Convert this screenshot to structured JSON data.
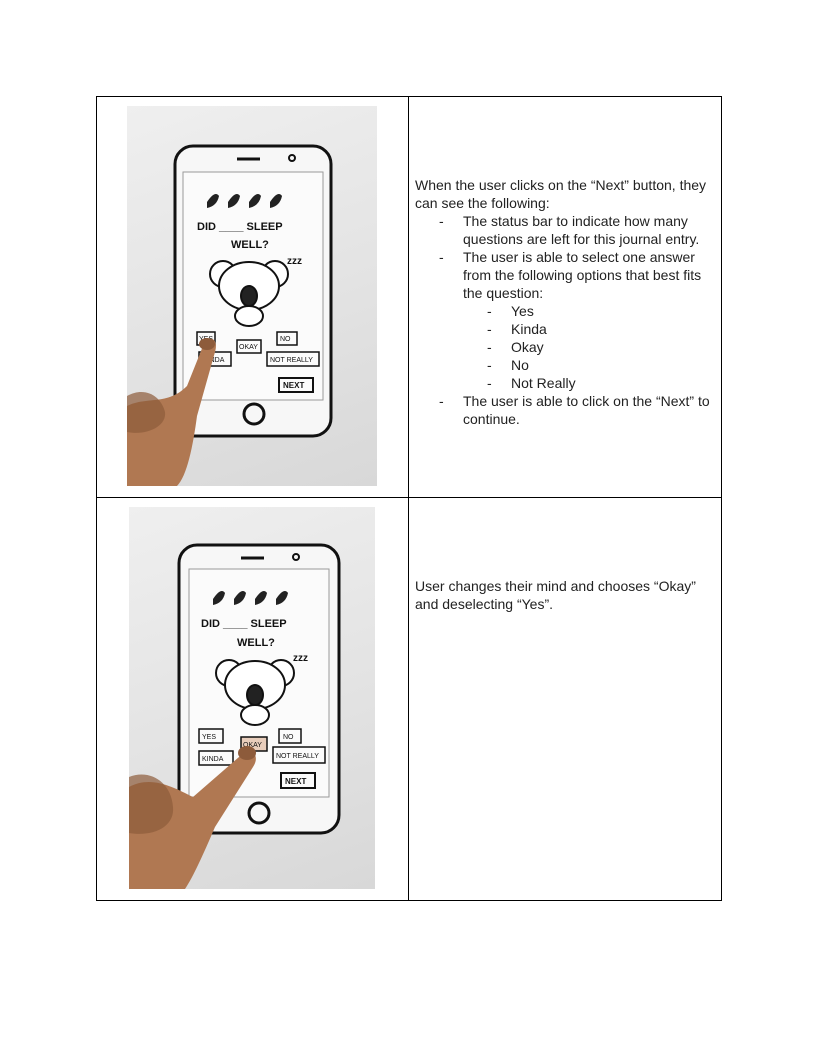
{
  "rows": [
    {
      "photo": {
        "sketch_question_line1": "DID ____ SLEEP",
        "sketch_question_line2": "WELL?",
        "sketch_options": [
          "YES",
          "KINDA",
          "OKAY",
          "NO",
          "NOT REALLY"
        ],
        "sketch_next": "NEXT",
        "sketch_zzz": "zzz"
      },
      "intro": "When the user clicks on the “Next” button, they can see the following:",
      "bullets": [
        "The status bar to indicate how many questions are left for this journal entry.",
        "The user is able to select one answer from the following options that best fits the question:",
        "The user is able to click on the “Next” to continue."
      ],
      "sub_bullets": [
        "Yes",
        "Kinda",
        "Okay",
        "No",
        "Not Really"
      ]
    },
    {
      "photo": {
        "sketch_question_line1": "DID ____ SLEEP",
        "sketch_question_line2": "WELL?",
        "sketch_options": [
          "YES",
          "KINDA",
          "OKAY",
          "NO",
          "NOT REALLY"
        ],
        "sketch_next": "NEXT",
        "sketch_zzz": "zzz"
      },
      "text": "User changes their mind and chooses “Okay” and deselecting “Yes”."
    }
  ]
}
